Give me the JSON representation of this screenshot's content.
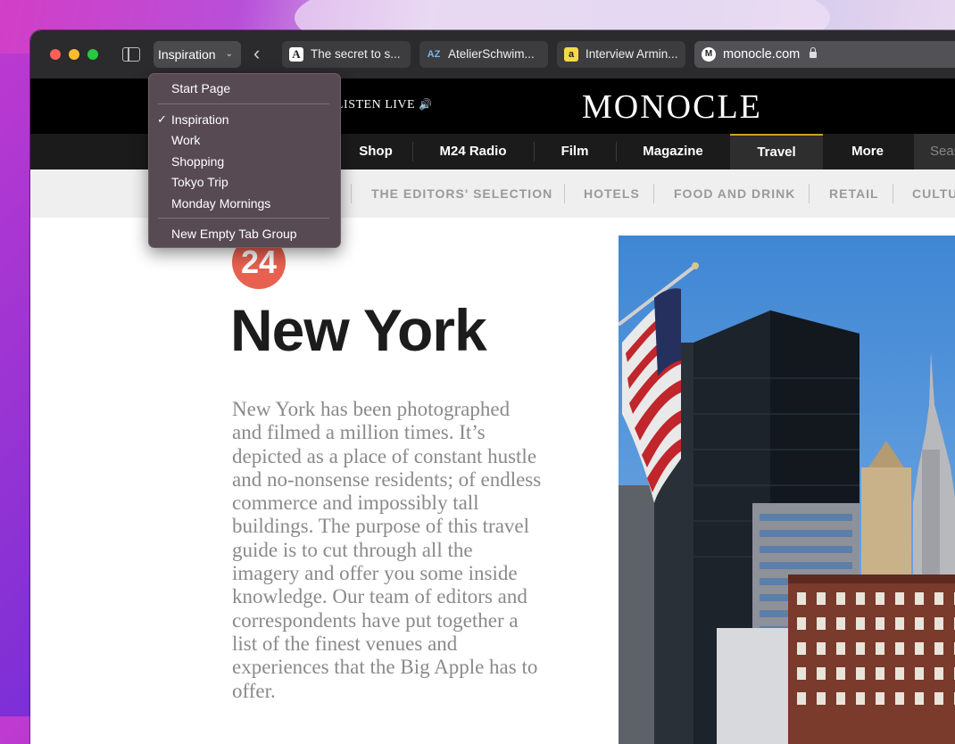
{
  "browser": {
    "tab_group_label": "Inspiration",
    "tabs": [
      {
        "title": "The secret to s...",
        "icon": "A-favicon"
      },
      {
        "title": "AtelierSchwim...",
        "icon": "AZ-favicon",
        "favicon_text": "AZ"
      },
      {
        "title": "Interview Armin...",
        "icon": "a-favicon",
        "favicon_text": "a"
      }
    ],
    "address": "monocle.com"
  },
  "tab_group_menu": {
    "start_page": "Start Page",
    "groups": [
      "Inspiration",
      "Work",
      "Shopping",
      "Tokyo Trip",
      "Monday Mornings"
    ],
    "checked": "Inspiration",
    "check_mark": "✓",
    "new_group": "New Empty Tab Group"
  },
  "site": {
    "listen_live": "LISTEN LIVE",
    "logo": "MONOCLE",
    "nav": [
      "Shop",
      "M24 Radio",
      "Film",
      "Magazine",
      "Travel",
      "More"
    ],
    "active_nav": "Travel",
    "search_placeholder": "Sear",
    "subnav": [
      "THE EDITORS' SELECTION",
      "HOTELS",
      "FOOD AND DRINK",
      "RETAIL",
      "CULTU"
    ]
  },
  "article": {
    "number": "24",
    "title": "New York",
    "body": "New York has been photographed and filmed a million times. It’s depicted as a place of constant hustle and no-nonsense residents; of endless commerce and impossibly tall buildings. The purpose of this travel guide is to cut through all the imagery and offer you some inside knowledge. Our team of editors and correspondents have put together a list of the finest venues and experiences that the Big Apple has to offer."
  },
  "colors": {
    "badge": "#e8604f",
    "travel_accent": "#c9a227"
  }
}
